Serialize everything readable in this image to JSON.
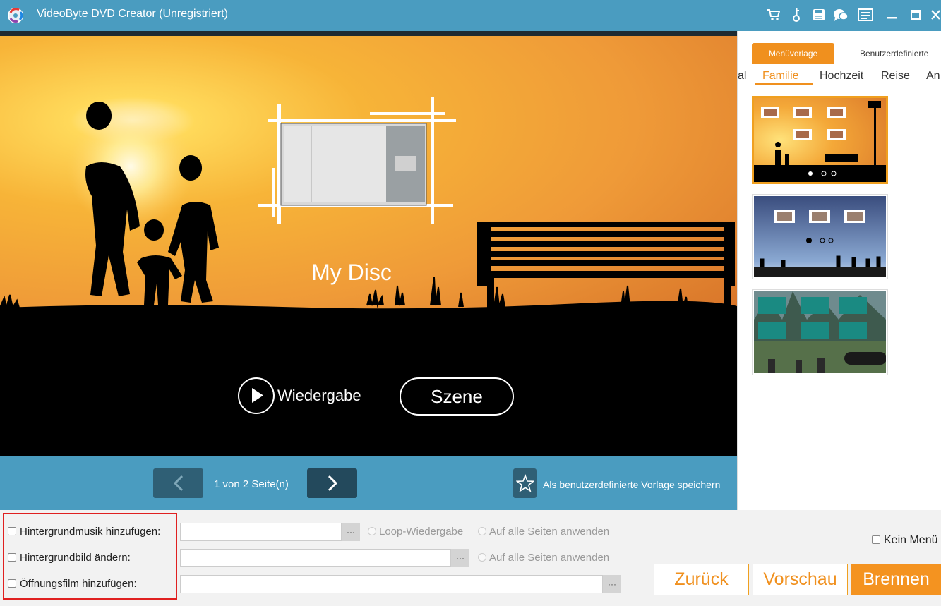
{
  "window": {
    "title": "VideoByte DVD Creator (Unregistriert)",
    "toolbar_icons": [
      "cart-icon",
      "key-icon",
      "save-icon",
      "chat-icon",
      "menu-list-icon",
      "minimize-icon",
      "maximize-icon",
      "close-icon"
    ]
  },
  "preview": {
    "disc_title": "My Disc",
    "play_label": "Wiedergabe",
    "scene_label": "Szene"
  },
  "navigation": {
    "page_info": "1 von 2 Seite(n)",
    "save_template_label": "Als benutzerdefinierte Vorlage speichern"
  },
  "right_panel": {
    "tabs": [
      {
        "label": "Menüvorlage",
        "active": true
      },
      {
        "label": "Benutzerdefinierte",
        "active": false
      }
    ],
    "categories": [
      "al",
      "Familie",
      "Hochzeit",
      "Reise",
      "An"
    ],
    "selected_category": "Familie"
  },
  "bottom": {
    "music_label": "Hintergrundmusik hinzufügen:",
    "image_label": "Hintergrundbild ändern:",
    "opening_label": "Öffnungsfilm hinzufügen:",
    "loop_label": "Loop-Wiedergabe",
    "apply_all_label": "Auf alle Seiten anwenden",
    "browse_label": "···",
    "no_menu_label": "Kein Menü",
    "back_label": "Zurück",
    "preview_label": "Vorschau",
    "burn_label": "Brennen"
  },
  "colors": {
    "title_bar": "#4a9cc0",
    "accent_orange": "#f0901e",
    "highlight_red": "#e02020"
  }
}
